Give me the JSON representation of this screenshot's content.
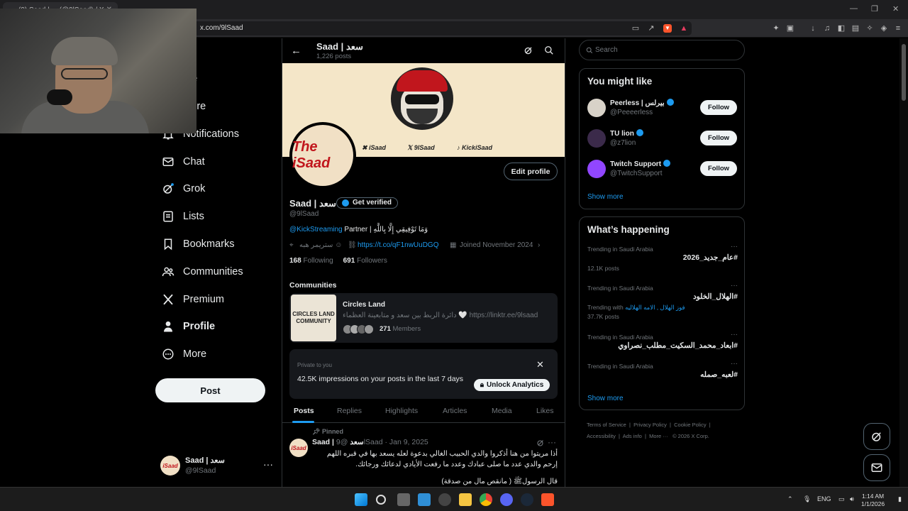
{
  "browser": {
    "tab_title": "(9) Saad | ... (@9lSaad) / X",
    "url": "x.com/9lSaad",
    "window_controls": [
      "—",
      "❐",
      "✕"
    ]
  },
  "nav": {
    "items": [
      {
        "label": "Home",
        "icon": "home-icon"
      },
      {
        "label": "Explore",
        "icon": "search-icon"
      },
      {
        "label": "Notifications",
        "icon": "bell-icon"
      },
      {
        "label": "Chat",
        "icon": "mail-icon"
      },
      {
        "label": "Grok",
        "icon": "grok-icon"
      },
      {
        "label": "Lists",
        "icon": "list-icon"
      },
      {
        "label": "Bookmarks",
        "icon": "bookmark-icon"
      },
      {
        "label": "Communities",
        "icon": "people-icon"
      },
      {
        "label": "Premium",
        "icon": "x-logo-icon"
      },
      {
        "label": "Profile",
        "icon": "person-icon"
      },
      {
        "label": "More",
        "icon": "more-circle-icon"
      }
    ],
    "visible_labels": {
      "home": "me",
      "explore": "plore"
    },
    "post_button": "Post",
    "account": {
      "name": "Saad | سعد",
      "handle": "@9lSaad",
      "avatar_text": "iSaad"
    }
  },
  "header": {
    "name": "Saad | سعد",
    "posts_count": "1,226 posts"
  },
  "banner": {
    "links": [
      "iSaad",
      "9lSaad",
      "KickiSaad"
    ]
  },
  "profile": {
    "avatar_text": "The iSaad",
    "edit_button": "Edit profile",
    "name": "Saad | سعد",
    "verified_button": "Get verified",
    "handle": "@9lSaad",
    "bio_link": "@KickStreaming",
    "bio_text": "Partner | وَمَا تَوْفِيقِي إِلَّا بِاللَّهِ",
    "location": "ستريمر هبه ☺",
    "website": "https://t.co/qF1nwUuDGQ",
    "joined": "Joined November 2024",
    "following_count": "168",
    "following_label": "Following",
    "followers_count": "691",
    "followers_label": "Followers"
  },
  "communities": {
    "heading": "Communities",
    "card": {
      "image_text": "CIRCLES LAND COMMUNITY",
      "title": "Circles Land",
      "description": "دائرة الربط بين سعد و متابعينة العظماء 🤍 https://linktr.ee/9lsaad",
      "members_count": "271",
      "members_label": "Members"
    }
  },
  "analytics": {
    "private_label": "Private to you",
    "text": "42.5K impressions on your posts in the last 7 days",
    "button": "Unlock Analytics"
  },
  "tabs": [
    "Posts",
    "Replies",
    "Highlights",
    "Articles",
    "Media",
    "Likes"
  ],
  "post": {
    "pinned": "Pinned",
    "author": "Saad | سعد",
    "meta": "@9lSaad · Jan 9, 2025",
    "body": "أذا مريتوا من هنا أذكروا والدي الحبيب الغالي بدعوة لعله يسعد بها في قبره اللهم إرحم والدي عدد ما صلى عبادك وعدد ما رفعت الأيادي لدعائك ورجائك.",
    "tail": "قال الرسولﷺ ( مانقص مال من صدقة)"
  },
  "sidebar": {
    "search_placeholder": "Search",
    "you_might_like": {
      "heading": "You might like",
      "accounts": [
        {
          "name": "Peerless | بيرلس",
          "handle": "@Peeeerless",
          "follow": "Follow",
          "avatar_color": "#d8d2c8"
        },
        {
          "name": "TU lion",
          "handle": "@z7lion",
          "follow": "Follow",
          "avatar_color": "#3b2a4a"
        },
        {
          "name": "Twitch Support",
          "handle": "@TwitchSupport",
          "follow": "Follow",
          "avatar_color": "#9146ff"
        }
      ],
      "show_more": "Show more"
    },
    "whats_happening": {
      "heading": "What’s happening",
      "trends": [
        {
          "context": "Trending in Saudi Arabia",
          "title": "#عام_جديد_2026",
          "posts": "12.1K posts"
        },
        {
          "context": "Trending in Saudi Arabia",
          "title": "#الهلال_الخلود",
          "trending_with": "Trending with",
          "trending_with_tags": "فوز الهلال , الامه الهلاليه",
          "posts": "37.7K posts"
        },
        {
          "context": "Trending in Saudi Arabia",
          "title": "#ابعاد_محمد_السكيت_مطلب_نصراوي"
        },
        {
          "context": "Trending in Saudi Arabia",
          "title": "#لعبه_صمله"
        }
      ],
      "show_more": "Show more"
    },
    "footer": {
      "links": [
        "Terms of Service",
        "Privacy Policy",
        "Cookie Policy",
        "Accessibility",
        "Ads info",
        "More ···"
      ],
      "copyright": "© 2026 X Corp."
    }
  },
  "taskbar": {
    "lang": "ENG",
    "time": "1:14 AM",
    "date": "1/1/2026"
  },
  "colors": {
    "accent": "#1d9bf0",
    "background": "#000000",
    "border": "#2f3336",
    "muted": "#71767b"
  }
}
